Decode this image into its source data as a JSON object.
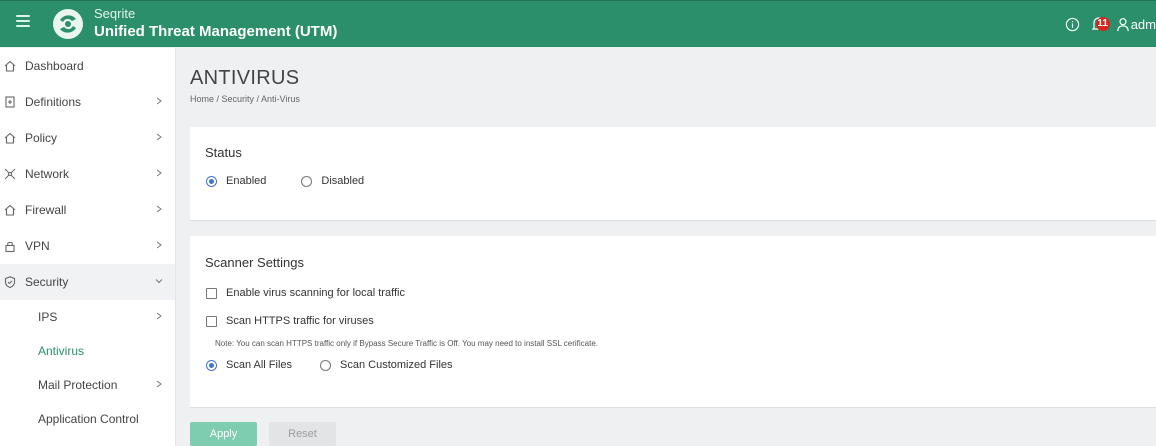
{
  "header": {
    "brand_small": "Seqrite",
    "brand_title": "Unified Threat Management (UTM)",
    "notification_count": "11",
    "user_label": "adm"
  },
  "sidebar": {
    "items": [
      {
        "label": "Dashboard",
        "icon": "home-icon"
      },
      {
        "label": "Definitions",
        "icon": "document-icon"
      },
      {
        "label": "Policy",
        "icon": "home-icon"
      },
      {
        "label": "Network",
        "icon": "network-icon"
      },
      {
        "label": "Firewall",
        "icon": "home-icon"
      },
      {
        "label": "VPN",
        "icon": "lock-icon"
      },
      {
        "label": "Security",
        "icon": "shield-icon"
      }
    ],
    "security_children": [
      {
        "label": "IPS"
      },
      {
        "label": "Antivirus"
      },
      {
        "label": "Mail Protection"
      },
      {
        "label": "Application Control"
      }
    ]
  },
  "page": {
    "title": "ANTIVIRUS",
    "breadcrumb": "Home / Security / Anti-Virus"
  },
  "status_card": {
    "title": "Status",
    "enabled_label": "Enabled",
    "disabled_label": "Disabled",
    "selected": "Enabled"
  },
  "scanner_card": {
    "title": "Scanner Settings",
    "local_traffic_label": "Enable virus scanning for local traffic",
    "https_label": "Scan HTTPS traffic for viruses",
    "note": "Note: You can scan HTTPS traffic only if Bypass Secure Traffic is Off. You may need to install SSL cerificate.",
    "scan_all_label": "Scan All Files",
    "scan_custom_label": "Scan Customized Files",
    "selected": "Scan All Files"
  },
  "actions": {
    "apply_label": "Apply",
    "reset_label": "Reset"
  },
  "colors": {
    "header_bg": "#2a8f6a",
    "accent": "#2a8f6a",
    "radio_blue": "#3d74c7",
    "badge_red": "#d9261c",
    "apply_bg": "#7fcdb0"
  }
}
